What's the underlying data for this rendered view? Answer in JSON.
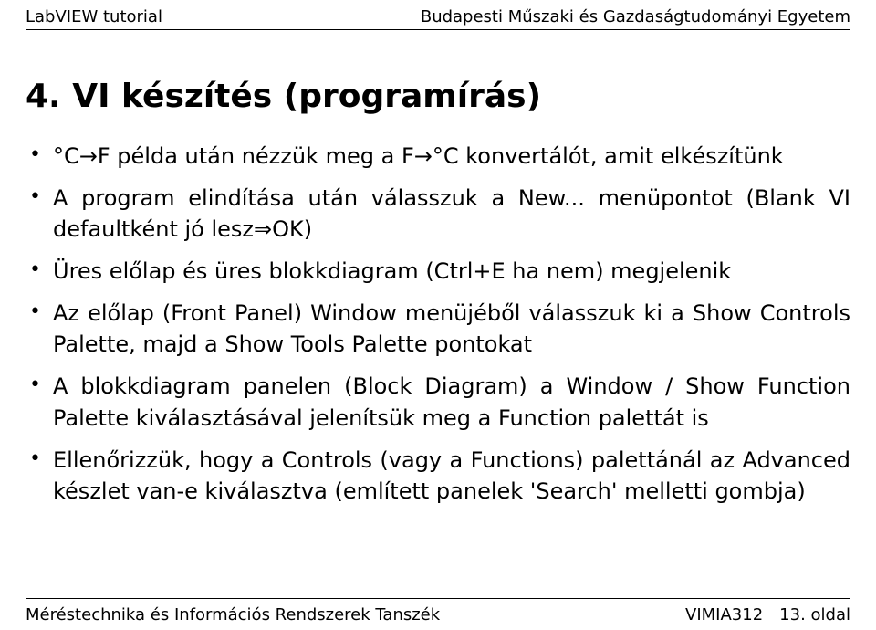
{
  "header": {
    "left": "LabVIEW tutorial",
    "right": "Budapesti Műszaki és Gazdaságtudományi Egyetem"
  },
  "title": "4.  VI készítés (programírás)",
  "bullets": [
    "°C→F példa után nézzük meg a F→°C konvertálót, amit elkészítünk",
    "A program elindítása után válasszuk a New... menüpontot (Blank VI defaultként jó lesz⇒OK)",
    "Üres előlap és üres blokkdiagram (Ctrl+E ha nem) megjelenik",
    "Az előlap (Front Panel) Window menüjéből válasszuk ki a Show Controls Palette, majd a Show Tools Palette pontokat",
    "A blokkdiagram panelen (Block Diagram) a Window / Show Function Palette kiválasztásával jelenítsük meg a Function palettát is",
    "Ellenőrizzük, hogy a Controls (vagy a Functions) palettánál az Advanced készlet van-e kiválasztva (említett panelek 'Search' melletti gombja)"
  ],
  "footer": {
    "left": "Méréstechnika és Információs Rendszerek Tanszék",
    "course": "VIMIA312",
    "page": "13. oldal"
  }
}
